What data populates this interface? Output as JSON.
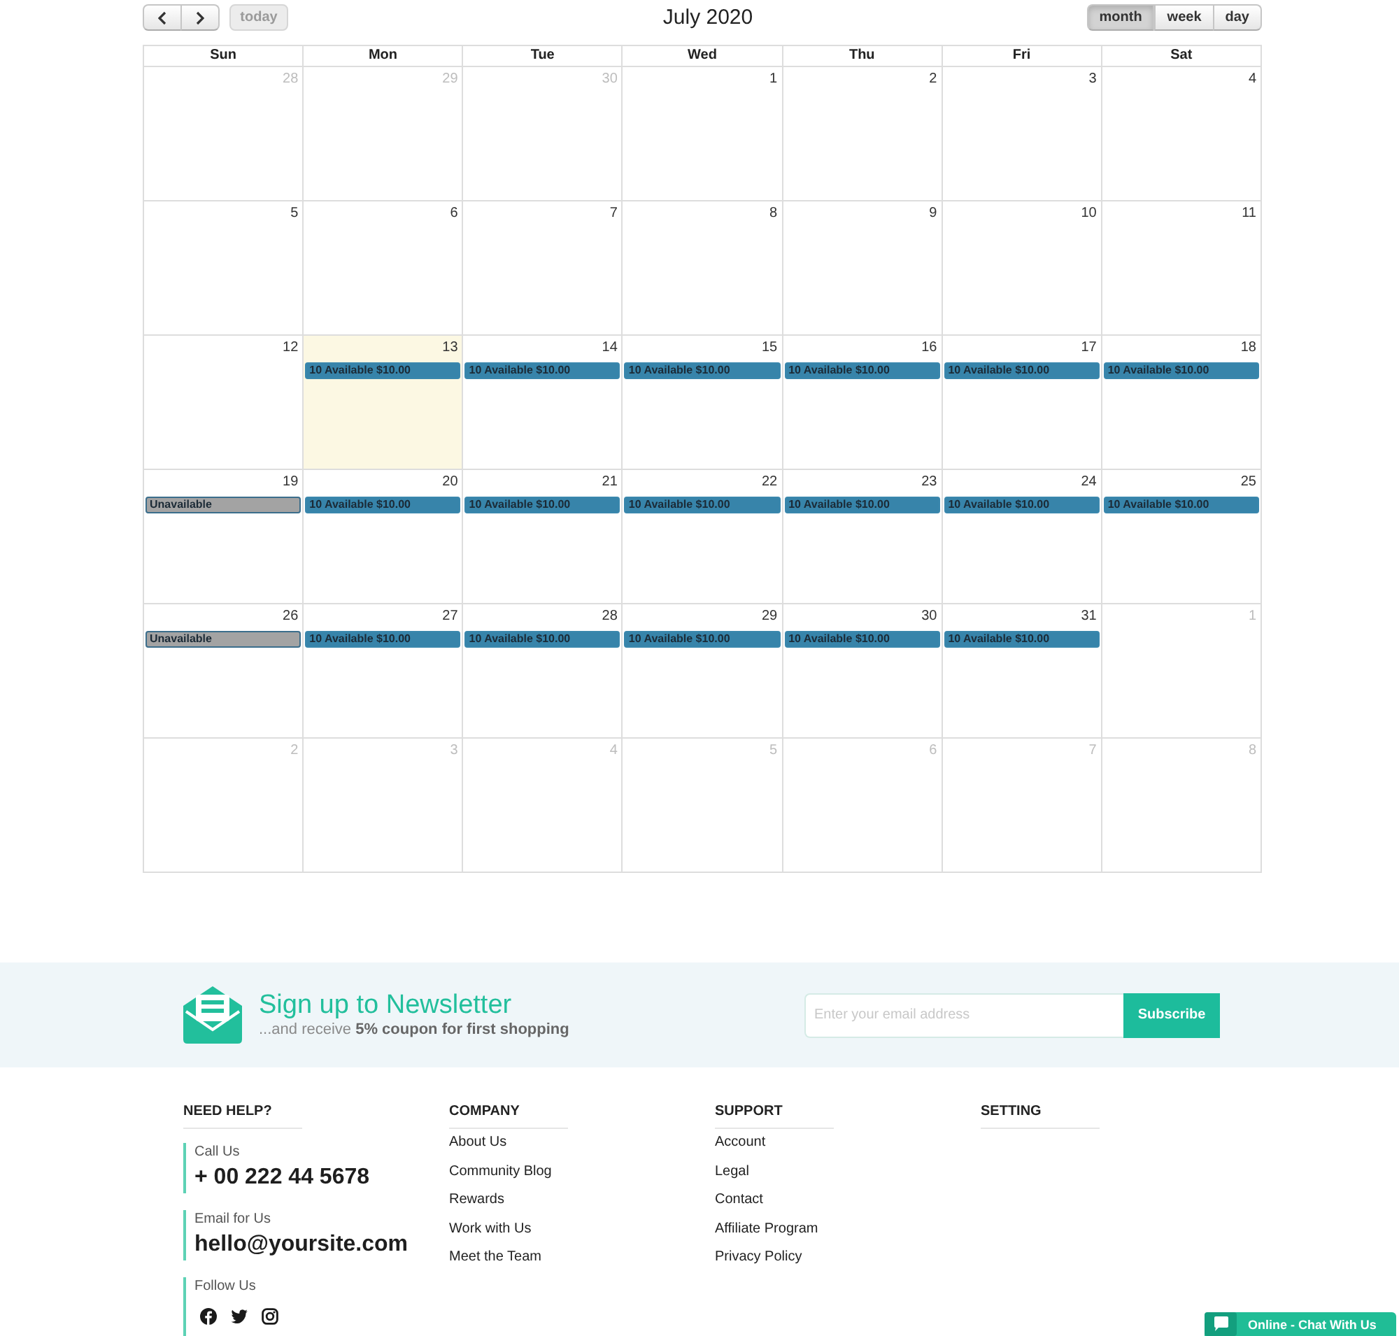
{
  "toolbar": {
    "today": {
      "label": "today",
      "disabled": true
    },
    "title": "July 2020",
    "views": [
      {
        "label": "month",
        "selected": true
      },
      {
        "label": "week",
        "selected": false
      },
      {
        "label": "day",
        "selected": false
      }
    ]
  },
  "calendar": {
    "weekdays": [
      "Sun",
      "Mon",
      "Tue",
      "Wed",
      "Thu",
      "Fri",
      "Sat"
    ],
    "weeks": [
      {
        "days": [
          {
            "day": "28",
            "other_month": true,
            "today": false
          },
          {
            "day": "29",
            "other_month": true,
            "today": false
          },
          {
            "day": "30",
            "other_month": true,
            "today": false
          },
          {
            "day": "1",
            "other_month": false,
            "today": false
          },
          {
            "day": "2",
            "other_month": false,
            "today": false
          },
          {
            "day": "3",
            "other_month": false,
            "today": false
          },
          {
            "day": "4",
            "other_month": false,
            "today": false
          }
        ]
      },
      {
        "days": [
          {
            "day": "5",
            "other_month": false,
            "today": false
          },
          {
            "day": "6",
            "other_month": false,
            "today": false
          },
          {
            "day": "7",
            "other_month": false,
            "today": false
          },
          {
            "day": "8",
            "other_month": false,
            "today": false
          },
          {
            "day": "9",
            "other_month": false,
            "today": false
          },
          {
            "day": "10",
            "other_month": false,
            "today": false
          },
          {
            "day": "11",
            "other_month": false,
            "today": false
          }
        ]
      },
      {
        "days": [
          {
            "day": "12",
            "other_month": false,
            "today": false
          },
          {
            "day": "13",
            "other_month": false,
            "today": true,
            "events": [
              {
                "kind": "available",
                "label": "10 Available $10.00"
              }
            ]
          },
          {
            "day": "14",
            "other_month": false,
            "today": false,
            "events": [
              {
                "kind": "available",
                "label": "10 Available $10.00"
              }
            ]
          },
          {
            "day": "15",
            "other_month": false,
            "today": false,
            "events": [
              {
                "kind": "available",
                "label": "10 Available $10.00"
              }
            ]
          },
          {
            "day": "16",
            "other_month": false,
            "today": false,
            "events": [
              {
                "kind": "available",
                "label": "10 Available $10.00"
              }
            ]
          },
          {
            "day": "17",
            "other_month": false,
            "today": false,
            "events": [
              {
                "kind": "available",
                "label": "10 Available $10.00"
              }
            ]
          },
          {
            "day": "18",
            "other_month": false,
            "today": false,
            "events": [
              {
                "kind": "available",
                "label": "10 Available $10.00"
              }
            ]
          }
        ]
      },
      {
        "days": [
          {
            "day": "19",
            "other_month": false,
            "today": false,
            "events": [
              {
                "kind": "unavailable",
                "label": "Unavailable"
              }
            ]
          },
          {
            "day": "20",
            "other_month": false,
            "today": false,
            "events": [
              {
                "kind": "available",
                "label": "10 Available $10.00"
              }
            ]
          },
          {
            "day": "21",
            "other_month": false,
            "today": false,
            "events": [
              {
                "kind": "available",
                "label": "10 Available $10.00"
              }
            ]
          },
          {
            "day": "22",
            "other_month": false,
            "today": false,
            "events": [
              {
                "kind": "available",
                "label": "10 Available $10.00"
              }
            ]
          },
          {
            "day": "23",
            "other_month": false,
            "today": false,
            "events": [
              {
                "kind": "available",
                "label": "10 Available $10.00"
              }
            ]
          },
          {
            "day": "24",
            "other_month": false,
            "today": false,
            "events": [
              {
                "kind": "available",
                "label": "10 Available $10.00"
              }
            ]
          },
          {
            "day": "25",
            "other_month": false,
            "today": false,
            "events": [
              {
                "kind": "available",
                "label": "10 Available $10.00"
              }
            ]
          }
        ]
      },
      {
        "days": [
          {
            "day": "26",
            "other_month": false,
            "today": false,
            "events": [
              {
                "kind": "unavailable",
                "label": "Unavailable"
              }
            ]
          },
          {
            "day": "27",
            "other_month": false,
            "today": false,
            "events": [
              {
                "kind": "available",
                "label": "10 Available $10.00"
              }
            ]
          },
          {
            "day": "28",
            "other_month": false,
            "today": false,
            "events": [
              {
                "kind": "available",
                "label": "10 Available $10.00"
              }
            ]
          },
          {
            "day": "29",
            "other_month": false,
            "today": false,
            "events": [
              {
                "kind": "available",
                "label": "10 Available $10.00"
              }
            ]
          },
          {
            "day": "30",
            "other_month": false,
            "today": false,
            "events": [
              {
                "kind": "available",
                "label": "10 Available $10.00"
              }
            ]
          },
          {
            "day": "31",
            "other_month": false,
            "today": false,
            "events": [
              {
                "kind": "available",
                "label": "10 Available $10.00"
              }
            ]
          },
          {
            "day": "1",
            "other_month": true,
            "today": false
          }
        ]
      },
      {
        "days": [
          {
            "day": "2",
            "other_month": true,
            "today": false
          },
          {
            "day": "3",
            "other_month": true,
            "today": false
          },
          {
            "day": "4",
            "other_month": true,
            "today": false
          },
          {
            "day": "5",
            "other_month": true,
            "today": false
          },
          {
            "day": "6",
            "other_month": true,
            "today": false
          },
          {
            "day": "7",
            "other_month": true,
            "today": false
          },
          {
            "day": "8",
            "other_month": true,
            "today": false
          }
        ]
      }
    ]
  },
  "newsletter": {
    "title": "Sign up to Newsletter",
    "subtitle": "...and receive **5% coupon for first shopping**",
    "placeholder": "Enter your email address",
    "button": "Subscribe"
  },
  "footer": {
    "columns": [
      {
        "kind": "contact",
        "heading": "NEED HELP?",
        "contacts": [
          {
            "label": "Call Us",
            "value": "+ 00 222 44 5678"
          },
          {
            "label": "Email for Us",
            "value": "hello@yoursite.com"
          }
        ],
        "follow_label": "Follow Us"
      },
      {
        "kind": "links",
        "heading": "COMPANY",
        "links": [
          "About Us",
          "Community Blog",
          "Rewards",
          "Work with Us",
          "Meet the Team"
        ]
      },
      {
        "kind": "links",
        "heading": "SUPPORT",
        "links": [
          "Account",
          "Legal",
          "Contact",
          "Affiliate Program",
          "Privacy Policy"
        ]
      },
      {
        "kind": "links",
        "heading": "SETTING"
      }
    ]
  },
  "chat": {
    "label": "Online - Chat With Us"
  }
}
